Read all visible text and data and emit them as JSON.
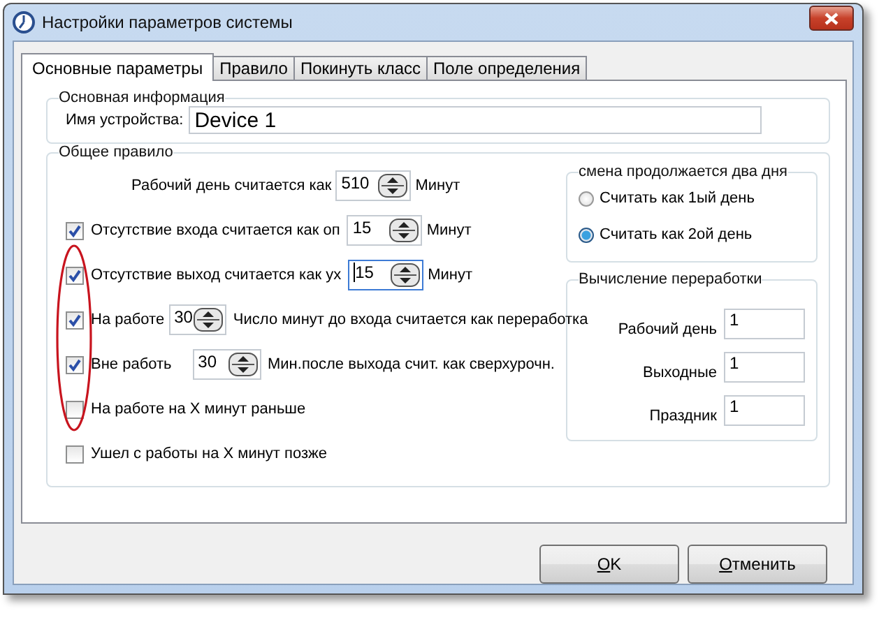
{
  "window": {
    "title": "Настройки параметров системы"
  },
  "tabs": [
    {
      "label": "Основные параметры",
      "selected": true
    },
    {
      "label": "Правило",
      "selected": false
    },
    {
      "label": "Покинуть класс",
      "selected": false
    },
    {
      "label": "Поле определения",
      "selected": false
    }
  ],
  "basic_info": {
    "title": "Основная информация",
    "device_label": "Имя устройства:",
    "device_value": "Device 1"
  },
  "general_rule": {
    "title": "Общее правило",
    "rows": [
      {
        "kind": "spin",
        "label": "Рабочий день считается как",
        "value": "510",
        "focused": false,
        "unit": "Минут"
      },
      {
        "kind": "check_spin",
        "checked": true,
        "label": "Отсутствие входа считается как оп",
        "value": "15",
        "focused": false,
        "unit": "Минут"
      },
      {
        "kind": "check_spin",
        "checked": true,
        "label": "Отсутствие выход считается как ух",
        "value": "15",
        "focused": true,
        "unit": "Минут"
      },
      {
        "kind": "check_spin_note",
        "checked": true,
        "label": "На работе",
        "value": "30",
        "focused": false,
        "note": "Число минут до входа считается как переработка"
      },
      {
        "kind": "check_spin_note",
        "checked": true,
        "label": "Вне работь",
        "value": "30",
        "focused": false,
        "note": "Мин.после выхода счит. как сверхурочн."
      },
      {
        "kind": "check",
        "checked": false,
        "label": "На работе на X минут раньше"
      },
      {
        "kind": "check",
        "checked": false,
        "label": "Ушел с работы на X минут позже"
      }
    ]
  },
  "two_day_shift": {
    "title": "смена продолжается два дня",
    "options": [
      {
        "label": "Считать как 1ый день",
        "selected": false
      },
      {
        "label": "Считать как 2ой день",
        "selected": true
      }
    ]
  },
  "overtime": {
    "title": "Вычисление переработки",
    "fields": [
      {
        "label": "Рабочий день",
        "value": "1"
      },
      {
        "label": "Выходные",
        "value": "1"
      },
      {
        "label": "Праздник",
        "value": "1"
      }
    ]
  },
  "buttons": [
    {
      "label": "OK"
    },
    {
      "label": "Отменить"
    }
  ]
}
